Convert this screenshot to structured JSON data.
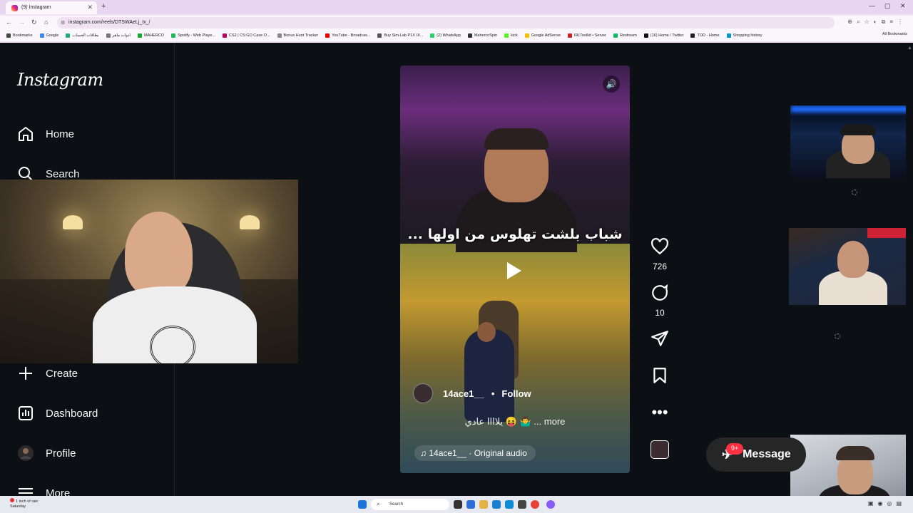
{
  "browser": {
    "tab_title": "(9) Instagram",
    "url": "instagram.com/reels/DTSWAeLj_Ix_/",
    "bookmarks": [
      "Bookmarks",
      "Google",
      "بطاقات الحساب",
      "ادوات ماهر",
      "MAHERCO",
      "Spotify - Web Playe...",
      "CS2 | CS:GO Case O...",
      "Bonus Hunt Tracker",
      "YouTube - Broadcas...",
      "Buy Sim-Lab P1X Ul...",
      "(2) WhatsApp",
      "MahercoSpin",
      "kick",
      "Google AdSense",
      "IRLToolkit • Server",
      "Restream",
      "(16) Home / Twitter",
      "TOD - Home",
      "Shopping history"
    ],
    "all_bookmarks": "All Bookmarks"
  },
  "sidebar": {
    "logo": "Instagram",
    "items": [
      {
        "label": "Home",
        "icon": "home-icon"
      },
      {
        "label": "Search",
        "icon": "search-icon"
      },
      {
        "label": "Create",
        "icon": "plus-icon"
      },
      {
        "label": "Dashboard",
        "icon": "dashboard-icon"
      },
      {
        "label": "Profile",
        "icon": "avatar-icon"
      },
      {
        "label": "More",
        "icon": "menu-icon"
      }
    ]
  },
  "reel": {
    "caption_overlay": "شباب بلشت تهلوس من اولها ...",
    "username": "14ace1__",
    "follow_label": "Follow",
    "description": "يلاااا عادي 😝 🤷‍♂️ ... more",
    "audio": "14ace1__ · Original audio"
  },
  "actions": {
    "likes": "726",
    "comments": "10"
  },
  "messages": {
    "label": "Message",
    "badge": "9+"
  },
  "taskbar": {
    "weather_line1": "1 inch of rain",
    "weather_line2": "Saturday",
    "search_placeholder": "Search"
  }
}
